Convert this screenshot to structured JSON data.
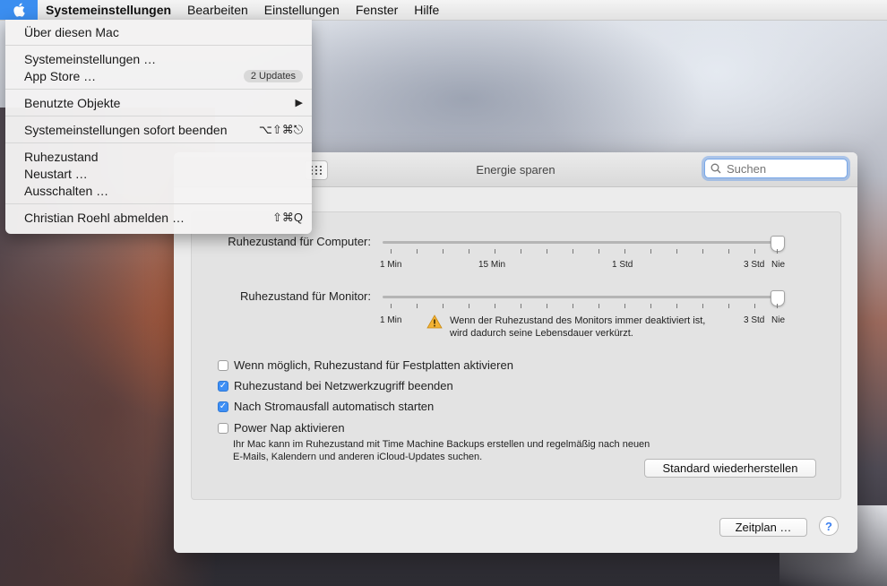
{
  "menubar": {
    "apple_icon": "apple-logo-icon",
    "items": [
      "Systemeinstellungen",
      "Bearbeiten",
      "Einstellungen",
      "Fenster",
      "Hilfe"
    ]
  },
  "apple_menu": {
    "about": "Über diesen Mac",
    "system_prefs": "Systemeinstellungen …",
    "app_store": "App Store …",
    "app_store_badge": "2 Updates",
    "recent_items": "Benutzte Objekte",
    "force_quit": "Systemeinstellungen sofort beenden",
    "force_quit_shortcut": "⌥⇧⌘⎋",
    "sleep": "Ruhezustand",
    "restart": "Neustart …",
    "shutdown": "Ausschalten …",
    "logout": "Christian Roehl abmelden …",
    "logout_shortcut": "⇧⌘Q"
  },
  "window": {
    "title": "Energie sparen",
    "search_placeholder": "Suchen",
    "computer_sleep_label": "Ruhezustand für Computer:",
    "computer_sleep_value": "Nie",
    "monitor_sleep_label": "Ruhezustand für Monitor:",
    "monitor_sleep_value": "Nie",
    "ticks": [
      "1 Min",
      "15 Min",
      "1 Std",
      "3 Std",
      "Nie"
    ],
    "monitor_ticks": [
      "1 Min",
      "3 Std",
      "Nie"
    ],
    "warning_line1": "Wenn der Ruhezustand des Monitors immer deaktiviert ist,",
    "warning_line2": "wird dadurch seine Lebensdauer verkürzt.",
    "options": [
      {
        "label": "Wenn möglich, Ruhezustand für Festplatten aktivieren",
        "checked": false
      },
      {
        "label": "Ruhezustand bei Netzwerkzugriff beenden",
        "checked": true
      },
      {
        "label": "Nach Stromausfall automatisch starten",
        "checked": true
      },
      {
        "label": "Power Nap aktivieren",
        "checked": false
      }
    ],
    "powernap_note1": "Ihr Mac kann im Ruhezustand mit Time Machine Backups erstellen und regelmäßig nach neuen",
    "powernap_note2": "E-Mails, Kalendern und anderen iCloud-Updates suchen.",
    "restore_defaults": "Standard wiederherstellen",
    "schedule": "Zeitplan …",
    "help": "?"
  },
  "colors": {
    "accent": "#3e8ff5",
    "menubar_selected": "#3b8ef0"
  }
}
